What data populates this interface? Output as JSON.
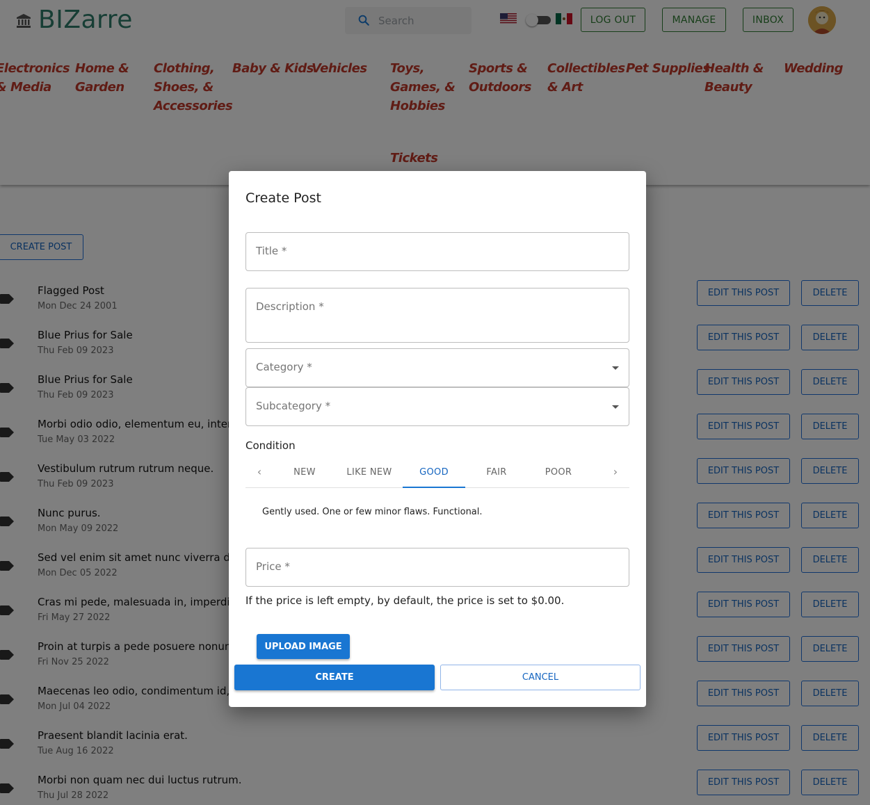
{
  "header": {
    "brand": "BIZarre",
    "search_placeholder": "Search",
    "logout_label": "LOG OUT",
    "manage_label": "MANAGE",
    "inbox_label": "INBOX"
  },
  "categories": [
    [
      "Electronics",
      "& Media"
    ],
    [
      "Home &",
      "Garden"
    ],
    [
      "Clothing,",
      "Shoes, &",
      "Accessories"
    ],
    [
      "Baby & Kids"
    ],
    [
      "Vehicles"
    ],
    [
      "Toys,",
      "Games, &",
      "Hobbies"
    ],
    [
      "Sports &",
      "Outdoors"
    ],
    [
      "Collectibles",
      "& Art"
    ],
    [
      "Pet Supplies"
    ],
    [
      "Health &",
      "Beauty"
    ],
    [
      "Wedding"
    ],
    [
      "Tickets"
    ]
  ],
  "page": {
    "create_post_label": "CREATE POST",
    "edit_label": "EDIT THIS POST",
    "delete_label": "DELETE"
  },
  "posts": [
    {
      "title": "Flagged Post",
      "date": "Mon Dec 24 2001"
    },
    {
      "title": "Blue Prius for Sale",
      "date": "Thu Feb 09 2023"
    },
    {
      "title": "Blue Prius for Sale",
      "date": "Thu Feb 09 2023"
    },
    {
      "title": "Morbi odio odio, elementum eu, interdu",
      "date": "Tue May 03 2022"
    },
    {
      "title": "Vestibulum rutrum rutrum neque.",
      "date": "Thu Feb 09 2023"
    },
    {
      "title": "Nunc purus.",
      "date": "Mon May 09 2022"
    },
    {
      "title": "Sed vel enim sit amet nunc viverra dapi",
      "date": "Mon Dec 05 2022"
    },
    {
      "title": "Cras mi pede, malesuada in, imperdiet e",
      "date": "Fri May 27 2022"
    },
    {
      "title": "Proin at turpis a pede posuere nonumm",
      "date": "Fri Nov 25 2022"
    },
    {
      "title": "Maecenas leo odio, condimentum id, luc",
      "date": "Mon Jul 04 2022"
    },
    {
      "title": "Praesent blandit lacinia erat.",
      "date": "Tue Aug 16 2022"
    },
    {
      "title": "Morbi non quam nec dui luctus rutrum.",
      "date": "Thu Jul 28 2022"
    }
  ],
  "dialog": {
    "title": "Create Post",
    "title_label": "Title *",
    "description_label": "Description *",
    "category_label": "Category *",
    "subcategory_label": "Subcategory *",
    "condition_label": "Condition",
    "conditions": [
      "NEW",
      "LIKE NEW",
      "GOOD",
      "FAIR",
      "POOR"
    ],
    "selected_condition": "GOOD",
    "condition_description": "Gently used. One or few minor flaws. Functional.",
    "price_label": "Price *",
    "price_help": "If the price is left empty, by default, the price is set to $0.00.",
    "upload_label": "UPLOAD IMAGE",
    "create_label": "CREATE",
    "cancel_label": "CANCEL"
  },
  "colors": {
    "brand": "#2e7d6b",
    "category_text": "#c0392b",
    "primary": "#1976d2",
    "header_button": "#2e7d32"
  }
}
